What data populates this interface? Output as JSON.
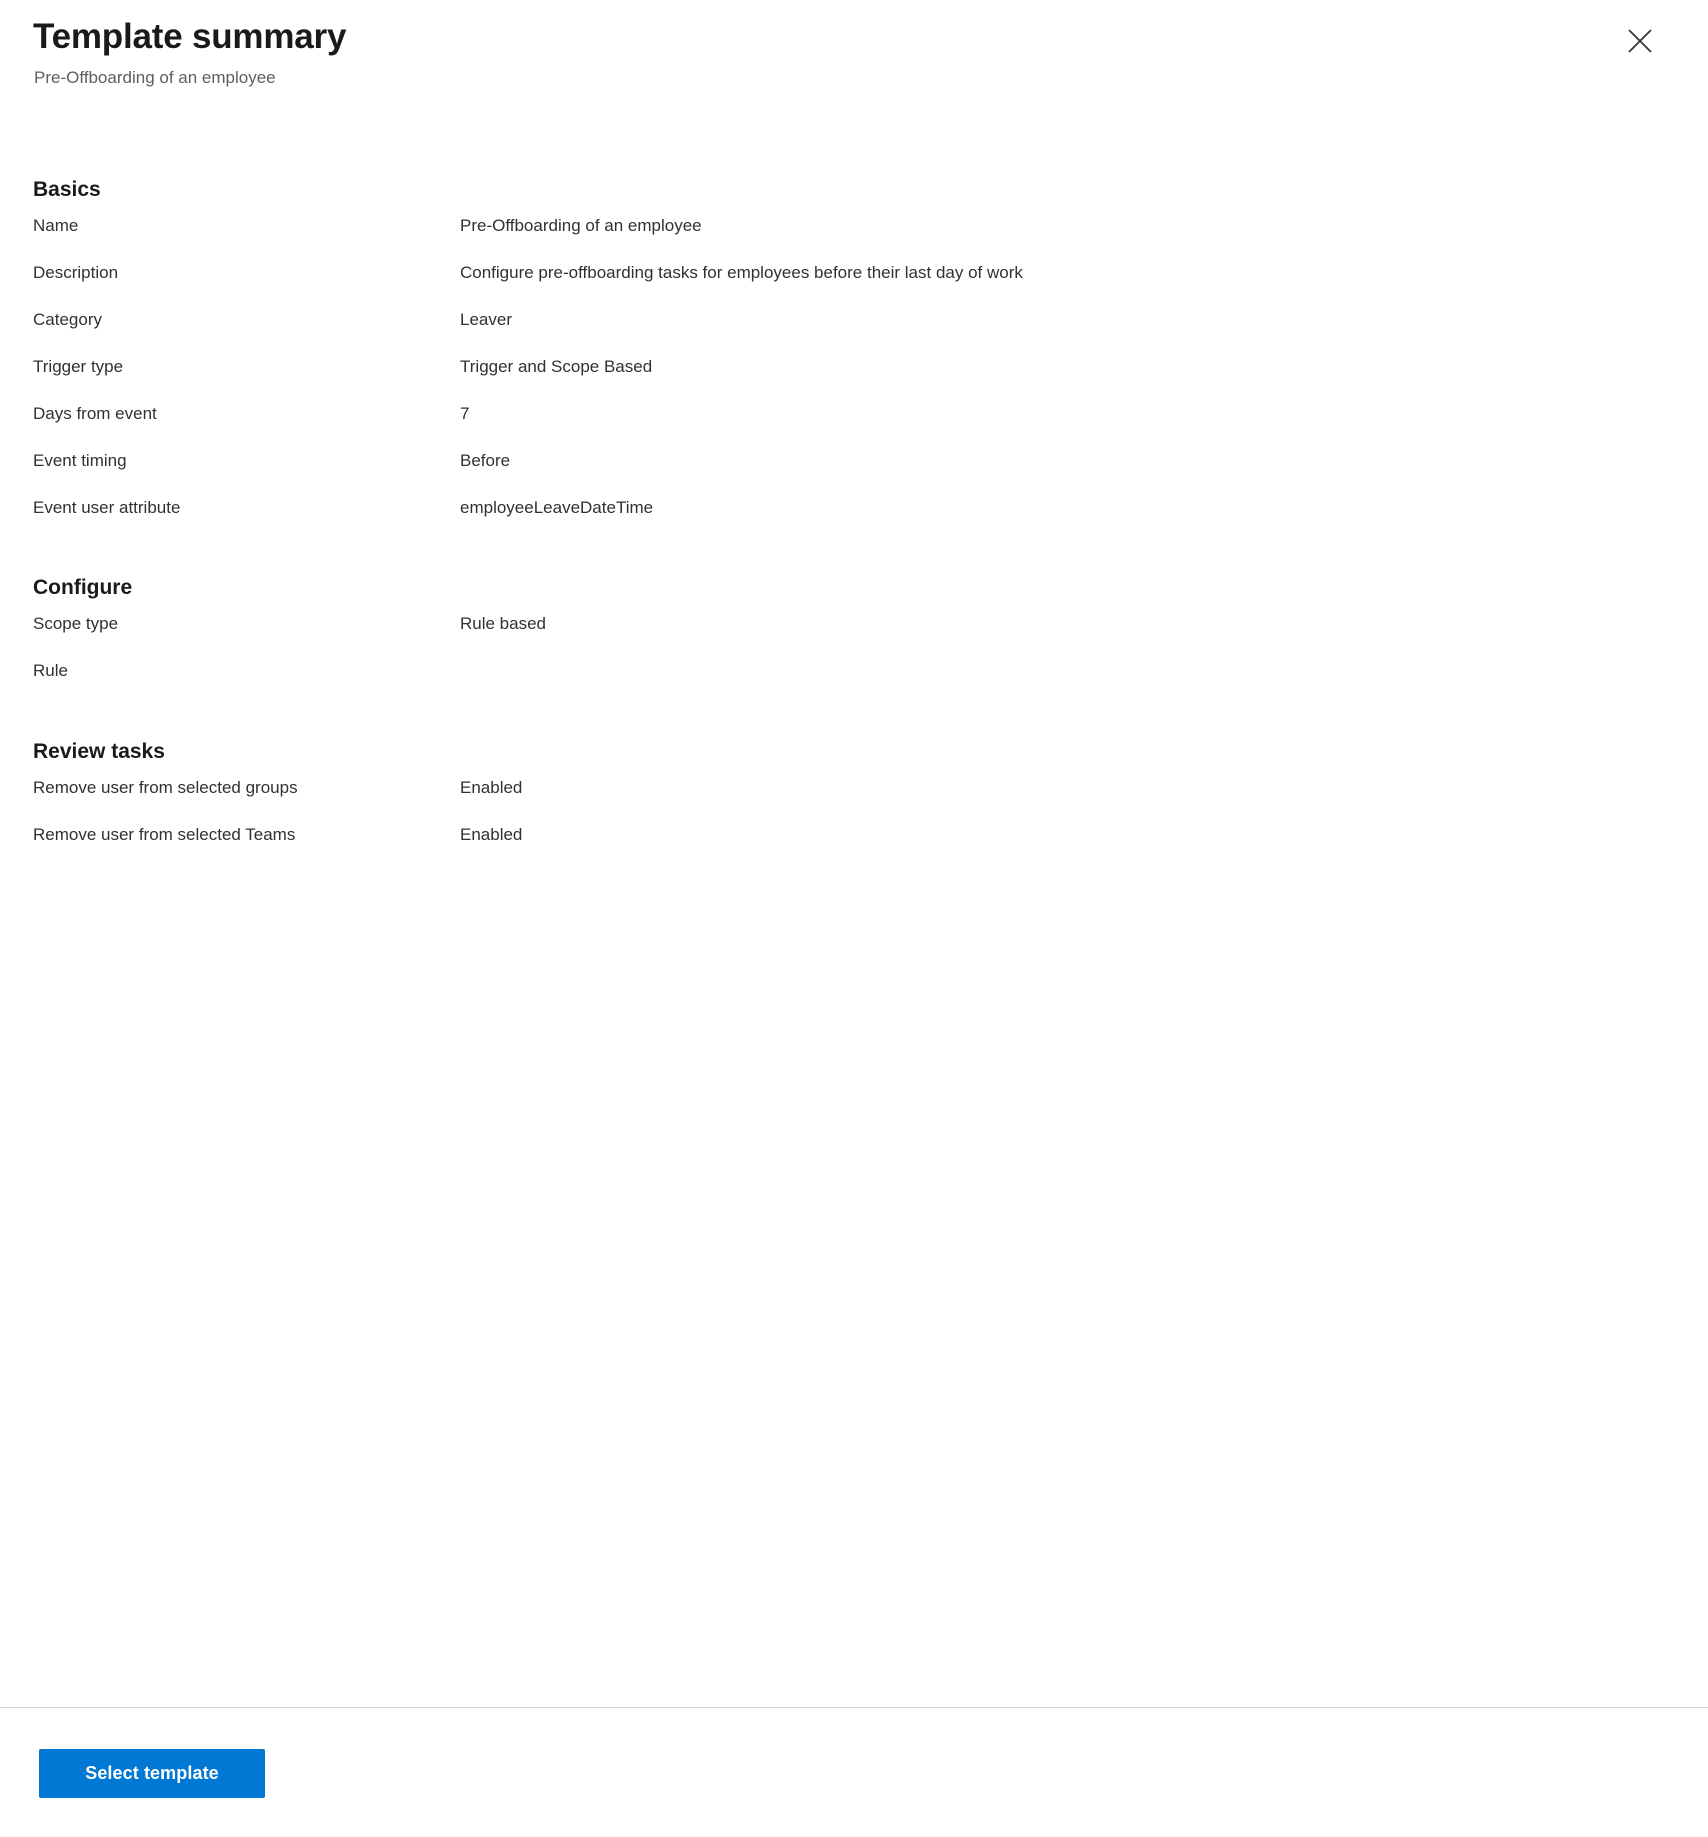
{
  "header": {
    "title": "Template summary",
    "subtitle": "Pre-Offboarding of an employee",
    "close_icon": "close-icon"
  },
  "sections": [
    {
      "heading": "Basics",
      "rows": [
        {
          "label": "Name",
          "value": "Pre-Offboarding of an employee"
        },
        {
          "label": "Description",
          "value": "Configure pre-offboarding tasks for employees before their last day of work"
        },
        {
          "label": "Category",
          "value": "Leaver"
        },
        {
          "label": "Trigger type",
          "value": "Trigger and Scope Based"
        },
        {
          "label": "Days from event",
          "value": "7"
        },
        {
          "label": "Event timing",
          "value": "Before"
        },
        {
          "label": "Event user attribute",
          "value": "employeeLeaveDateTime"
        }
      ]
    },
    {
      "heading": "Configure",
      "rows": [
        {
          "label": "Scope type",
          "value": "Rule based"
        },
        {
          "label": "Rule",
          "value": ""
        }
      ]
    },
    {
      "heading": "Review tasks",
      "rows": [
        {
          "label": "Remove user from selected groups",
          "value": "Enabled"
        },
        {
          "label": "Remove user from selected Teams",
          "value": "Enabled"
        }
      ]
    }
  ],
  "footer": {
    "primary_button_label": "Select template"
  },
  "colors": {
    "primary": "#0078d4",
    "title_text": "#1b1a19",
    "body_text": "#323130",
    "subtitle_text": "#605e5c",
    "divider": "#d6d6d6",
    "background": "#ffffff"
  }
}
